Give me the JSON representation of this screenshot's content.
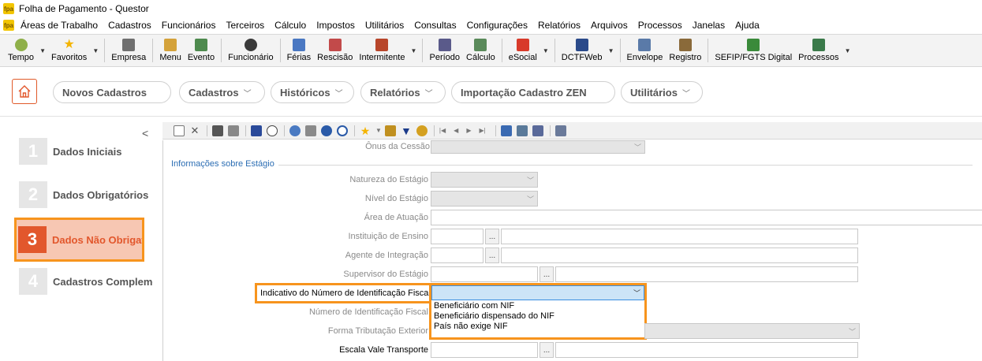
{
  "window": {
    "title": "Folha de Pagamento - Questor"
  },
  "menu": [
    "Áreas de Trabalho",
    "Cadastros",
    "Funcionários",
    "Terceiros",
    "Cálculo",
    "Impostos",
    "Utilitários",
    "Consultas",
    "Configurações",
    "Relatórios",
    "Arquivos",
    "Processos",
    "Janelas",
    "Ajuda"
  ],
  "toolbar": {
    "tempo": "Tempo",
    "favoritos": "Favoritos",
    "empresa": "Empresa",
    "menu": "Menu",
    "evento": "Evento",
    "funcionario": "Funcionário",
    "ferias": "Férias",
    "rescisao": "Rescisão",
    "intermitente": "Intermitente",
    "periodo": "Período",
    "calculo": "Cálculo",
    "esocial": "eSocial",
    "dctfweb": "DCTFWeb",
    "envelope": "Envelope",
    "registro": "Registro",
    "sefip": "SEFIP/FGTS Digital",
    "processos": "Processos"
  },
  "ribbon": {
    "novos_cadastros": "Novos Cadastros",
    "cadastros": "Cadastros",
    "historicos": "Históricos",
    "relatorios": "Relatórios",
    "importacao": "Importação Cadastro ZEN",
    "utilitarios": "Utilitários"
  },
  "steps": [
    {
      "num": "1",
      "label": "Dados Iniciais"
    },
    {
      "num": "2",
      "label": "Dados Obrigatórios"
    },
    {
      "num": "3",
      "label": "Dados Não Obrigatórios"
    },
    {
      "num": "4",
      "label": "Cadastros Complementares"
    }
  ],
  "form": {
    "onus_cessao": "Ônus da Cessão",
    "section_estagio": "Informações sobre Estágio",
    "natureza_estagio": "Natureza do Estágio",
    "nivel_estagio": "Nível do Estágio",
    "area_atuacao": "Área de Atuação",
    "instituicao_ensino": "Instituição de Ensino",
    "agente_integracao": "Agente de Integração",
    "supervisor_estagio": "Supervisor do Estágio",
    "indicativo_nif": "Indicativo do Número de Identificação Fiscal",
    "numero_nif": "Número de Identificação Fiscal",
    "forma_tributacao": "Forma Tributação Exterior",
    "escala_vale": "Escala Vale Transporte",
    "dots": "...",
    "nif_options": [
      "Beneficiário com NIF",
      "Beneficiário dispensado do NIF",
      "País não exige NIF"
    ]
  },
  "colors": {
    "accent": "#e2572c",
    "highlight": "#f7941d",
    "section": "#2b6db3"
  }
}
